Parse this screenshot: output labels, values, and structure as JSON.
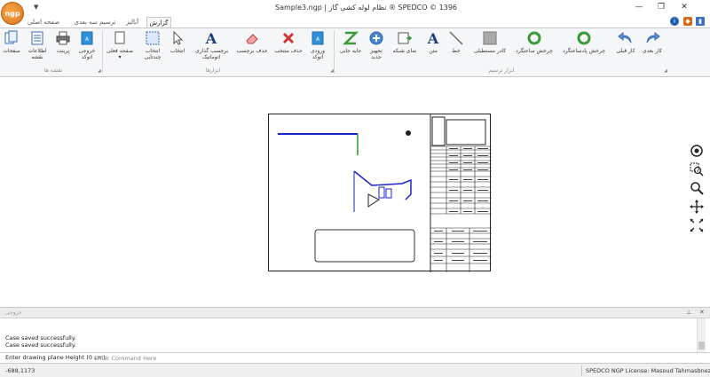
{
  "window": {
    "title": "Sample3.ngp | نظام لوله کشی گاز  ®  SPEDCO ©  1396",
    "logo_text": "ngp",
    "minimize": "—",
    "restore": "❐",
    "close": "✕"
  },
  "tabs": [
    {
      "label": "صفحه اصلی"
    },
    {
      "label": "ترسیم سه بعدی"
    },
    {
      "label": "آنالیز"
    },
    {
      "label": "گزارش"
    }
  ],
  "ribbon": {
    "groups": {
      "sheets": "نقشه ها",
      "tools": "ابزارها",
      "drawing_tools": "ابزار ترسیم"
    },
    "buttons": {
      "pages": "صفحات",
      "map_info_1": "اطلاعات",
      "map_info_2": "نقشه",
      "print": "پرینت",
      "autocad_export_1": "خروجی",
      "autocad_export_2": "اتوکد",
      "current_page_1": "صفحه فعلی",
      "multi_select_1": "انتخاب",
      "multi_select_2": "چندتایی",
      "select": "انتخاب",
      "auto_label_1": "برچسب گذاری",
      "auto_label_2": "اتوماتیک",
      "delete_label": "حذف برچسب",
      "delete_source": "حذف منتخب",
      "autocad_import_1": "ورودی",
      "autocad_import_2": "اتوکد",
      "relocate": "جابه جایی",
      "new_equip_1": "تجهیز",
      "new_equip_2": "جدید",
      "grid_view": "نمای شبکه",
      "text": "متن",
      "line": "خط",
      "rectangle": "کادر مستطیلی",
      "rotate_cw": "چرخش ساعتگرد",
      "rotate_ccw": "چرخش پادساعتگرد",
      "undo": "کار قبلی",
      "redo": "کار بعدی"
    }
  },
  "output_panel": {
    "title": "خروجی",
    "pin": "⊥",
    "close": "✕",
    "lines": [
      "Case saved successfully.",
      "Case saved successfully."
    ]
  },
  "command": {
    "label": "Enter drawing plane Height (0 cm):",
    "placeholder": "Enter Command Here"
  },
  "status": {
    "coordinates": "-688,1173",
    "license": "SPEDCO NGP License:   Masoud Tahmasbnezhad"
  },
  "colors": {
    "accent": "#2b579a",
    "pipe": "#1a23c8",
    "pipe_green": "#2a9d2a",
    "logo": "#e08020"
  }
}
